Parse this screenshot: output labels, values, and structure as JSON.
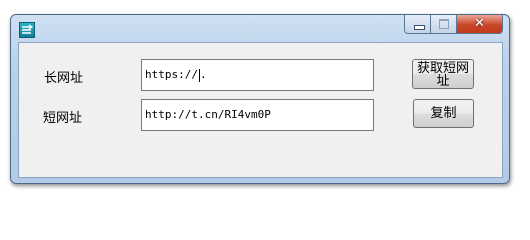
{
  "window": {
    "title": "",
    "controls": {
      "minimize": "minimize",
      "maximize": "maximize",
      "close": "✕"
    }
  },
  "form": {
    "long_url_label": "长网址",
    "long_url_value": "https://",
    "long_url_suffix": ".",
    "short_url_label": "短网址",
    "short_url_value": "http://t.cn/RI4vm0P",
    "fetch_button_label": "获取短网址",
    "copy_button_label": "复制"
  },
  "colors": {
    "title_gradient_top": "#cfe0f2",
    "client_bg": "#f0f0f0",
    "close_button": "#c9462a"
  }
}
